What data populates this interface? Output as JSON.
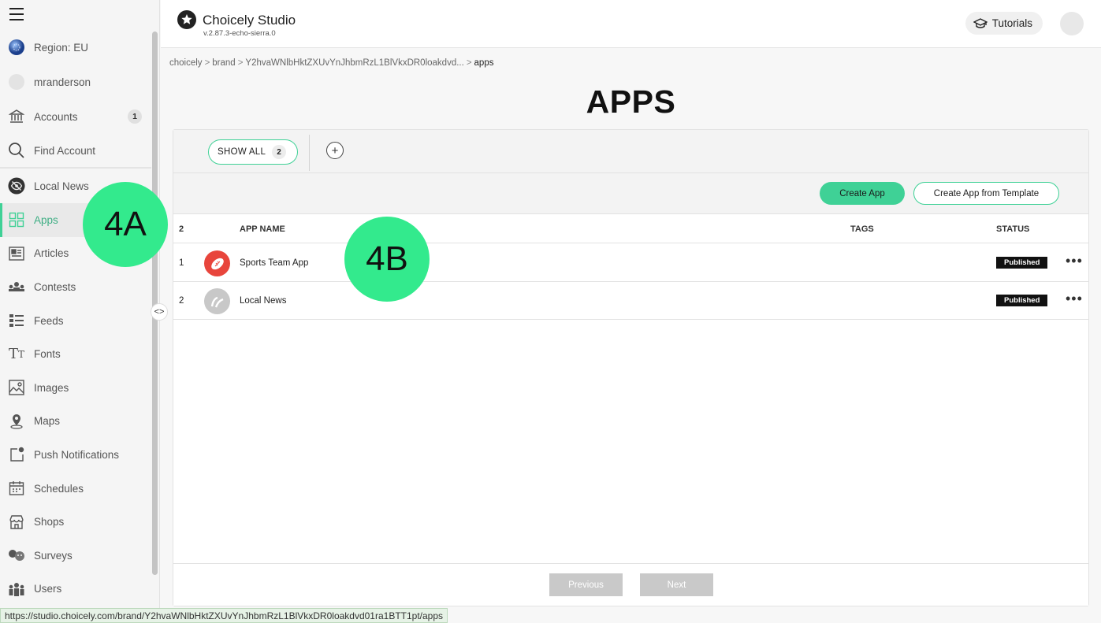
{
  "sidebar": {
    "items": [
      {
        "label": "Region: EU"
      },
      {
        "label": "mranderson"
      },
      {
        "label": "Accounts",
        "badge": "1"
      },
      {
        "label": "Find Account"
      },
      {
        "label": "Local News"
      },
      {
        "label": "Apps"
      },
      {
        "label": "Articles"
      },
      {
        "label": "Contests"
      },
      {
        "label": "Feeds"
      },
      {
        "label": "Fonts"
      },
      {
        "label": "Images"
      },
      {
        "label": "Maps"
      },
      {
        "label": "Push Notifications"
      },
      {
        "label": "Schedules"
      },
      {
        "label": "Shops"
      },
      {
        "label": "Surveys"
      },
      {
        "label": "Users"
      }
    ],
    "collapse_label": "<>"
  },
  "header": {
    "title": "Choicely Studio",
    "version": "v.2.87.3-echo-sierra.0",
    "tutorials_label": "Tutorials"
  },
  "breadcrumb": {
    "items": [
      "choicely",
      "brand",
      "Y2hvaWNlbHktZXUvYnJhbmRzL1BlVkxDR0loakdvd..."
    ],
    "current": "apps",
    "separator": ">"
  },
  "page": {
    "title": "APPS"
  },
  "filters": {
    "show_all_label": "SHOW ALL",
    "show_all_count": "2",
    "add_label": "+"
  },
  "actions": {
    "create_app": "Create App",
    "create_from_template": "Create App from Template"
  },
  "table": {
    "count": "2",
    "headers": {
      "name": "APP NAME",
      "tags": "TAGS",
      "status": "STATUS"
    },
    "rows": [
      {
        "num": "1",
        "name": "Sports Team App",
        "status": "Published",
        "more": "•••"
      },
      {
        "num": "2",
        "name": "Local News",
        "status": "Published",
        "more": "•••"
      }
    ]
  },
  "pagination": {
    "previous": "Previous",
    "next": "Next"
  },
  "callouts": {
    "a": "4A",
    "b": "4B"
  },
  "status_bar": {
    "url": "https://studio.choicely.com/brand/Y2hvaWNlbHktZXUvYnJhbmRzL1BlVkxDR0loakdvd01ra1BTT1pt/apps"
  },
  "colors": {
    "accent": "#3fd196",
    "callout": "#33ea8d",
    "published": "#111111"
  }
}
